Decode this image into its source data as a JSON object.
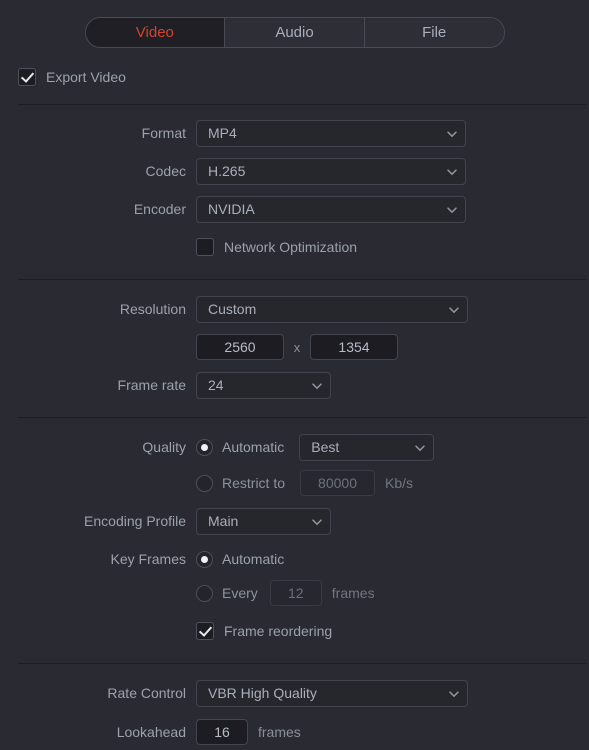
{
  "tabs": [
    {
      "label": "Video",
      "active": true
    },
    {
      "label": "Audio",
      "active": false
    },
    {
      "label": "File",
      "active": false
    }
  ],
  "export_video": {
    "label": "Export Video",
    "checked": true
  },
  "format_section": {
    "format": {
      "label": "Format",
      "value": "MP4"
    },
    "codec": {
      "label": "Codec",
      "value": "H.265"
    },
    "encoder": {
      "label": "Encoder",
      "value": "NVIDIA"
    },
    "network_optimization": {
      "label": "Network Optimization",
      "checked": false
    }
  },
  "resolution_section": {
    "resolution": {
      "label": "Resolution",
      "value": "Custom"
    },
    "width": "2560",
    "separator": "x",
    "height": "1354",
    "frame_rate": {
      "label": "Frame rate",
      "value": "24"
    }
  },
  "quality_section": {
    "quality_label": "Quality",
    "automatic_label": "Automatic",
    "automatic_value": "Best",
    "restrict_label": "Restrict to",
    "restrict_value": "80000",
    "restrict_unit": "Kb/s",
    "encoding_profile": {
      "label": "Encoding Profile",
      "value": "Main"
    },
    "key_frames_label": "Key Frames",
    "key_frames_automatic_label": "Automatic",
    "key_frames_every_label": "Every",
    "key_frames_every_value": "12",
    "key_frames_unit": "frames",
    "frame_reordering": {
      "label": "Frame reordering",
      "checked": true
    }
  },
  "rate_section": {
    "rate_control": {
      "label": "Rate Control",
      "value": "VBR High Quality"
    },
    "lookahead": {
      "label": "Lookahead",
      "value": "16",
      "unit": "frames"
    }
  },
  "colors": {
    "background": "#2a2a32",
    "accent": "#d4452e",
    "text": "#9aa2ac",
    "field": "#1c1c22"
  }
}
